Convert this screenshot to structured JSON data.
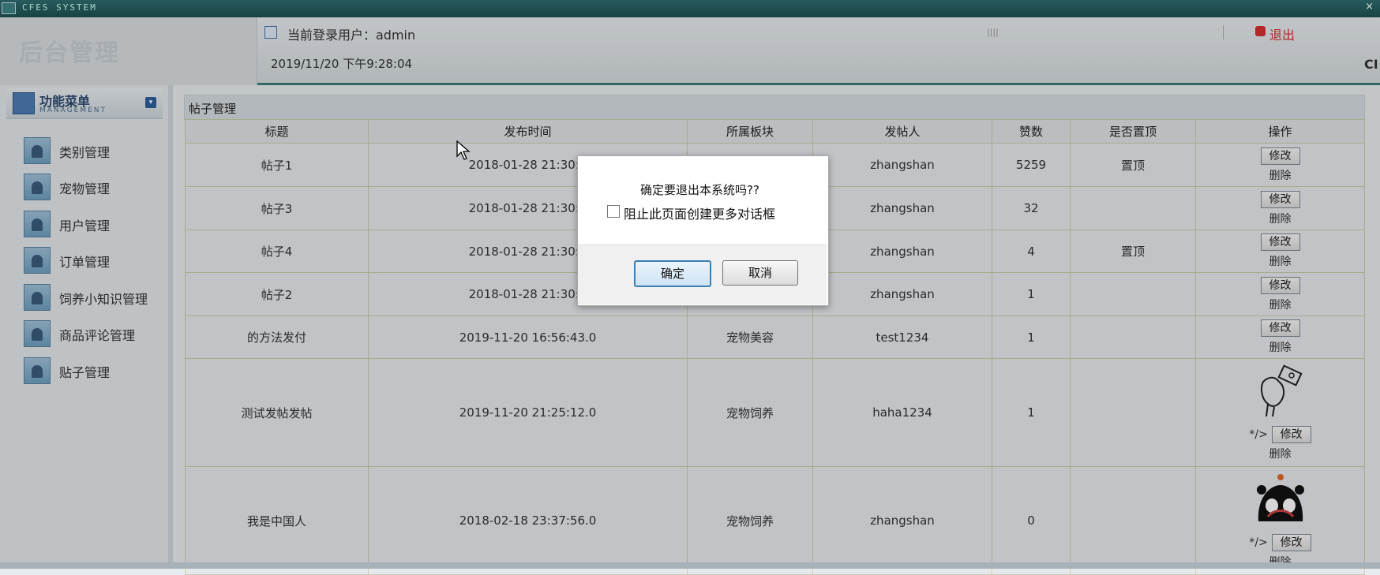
{
  "window": {
    "title": "CFES SYSTEM",
    "close": "×"
  },
  "header": {
    "brand": "后台管理",
    "current_user_label": "当前登录用户：admin",
    "datetime": "2019/11/20 下午9:28:04",
    "logout": "退出",
    "cut_text": "CI"
  },
  "sidebar": {
    "title": "功能菜单",
    "subtitle": "MANAGEMENT",
    "items": [
      {
        "label": "类别管理"
      },
      {
        "label": "宠物管理"
      },
      {
        "label": "用户管理"
      },
      {
        "label": "订单管理"
      },
      {
        "label": "饲养小知识管理"
      },
      {
        "label": "商品评论管理"
      },
      {
        "label": "贴子管理"
      }
    ]
  },
  "main": {
    "panel_title": "帖子管理",
    "columns": [
      "标题",
      "发布时间",
      "所属板块",
      "发帖人",
      "赞数",
      "是否置顶",
      "操作"
    ],
    "rows": [
      {
        "title": "帖子1",
        "time": "2018-01-28 21:30:2",
        "board": "",
        "author": "zhangshan",
        "likes": "5259",
        "sticky": "置顶"
      },
      {
        "title": "帖子3",
        "time": "2018-01-28 21:30:2",
        "board": "",
        "author": "zhangshan",
        "likes": "32",
        "sticky": ""
      },
      {
        "title": "帖子4",
        "time": "2018-01-28 21:30:2",
        "board": "",
        "author": "zhangshan",
        "likes": "4",
        "sticky": "置顶"
      },
      {
        "title": "帖子2",
        "time": "2018-01-28 21:30:2",
        "board": "",
        "author": "zhangshan",
        "likes": "1",
        "sticky": ""
      },
      {
        "title": "的方法发付",
        "time": "2019-11-20 16:56:43.0",
        "board": "宠物美容",
        "author": "test1234",
        "likes": "1",
        "sticky": ""
      },
      {
        "title": "测试发帖发帖",
        "time": "2019-11-20 21:25:12.0",
        "board": "宠物饲养",
        "author": "haha1234",
        "likes": "1",
        "sticky": ""
      },
      {
        "title": "我是中国人",
        "time": "2018-02-18 23:37:56.0",
        "board": "宠物饲养",
        "author": "zhangshan",
        "likes": "0",
        "sticky": ""
      }
    ],
    "edit_label": "修改",
    "delete_label": "删除",
    "img_residue": "*/>"
  },
  "dialog": {
    "message": "确定要退出本系统吗??",
    "checkbox_label": "阻止此页面创建更多对话框",
    "checkbox_checked": false,
    "ok_label": "确定",
    "cancel_label": "取消"
  },
  "colors": {
    "accent": "#3e7c7d",
    "logout": "#d3302f",
    "dialog_primary_border": "#3c7fb1"
  }
}
